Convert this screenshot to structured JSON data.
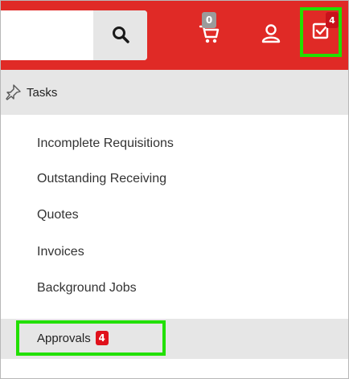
{
  "colors": {
    "brand_red": "#e02a26",
    "highlight_green": "#22e000",
    "badge_red": "#c8111b",
    "badge_gray": "#9b9b9b",
    "panel_gray": "#e6e6e6"
  },
  "topbar": {
    "search": {
      "value": "",
      "placeholder": "",
      "icon": "search-icon"
    },
    "cart": {
      "icon": "cart-icon",
      "count": "0"
    },
    "user": {
      "icon": "user-icon"
    },
    "tasks": {
      "icon": "checkbox-icon",
      "count": "4"
    }
  },
  "panel": {
    "header": {
      "icon": "pin-icon",
      "title": "Tasks"
    },
    "items": [
      {
        "label": "Incomplete Requisitions"
      },
      {
        "label": "Outstanding Receiving"
      },
      {
        "label": "Quotes"
      },
      {
        "label": "Invoices"
      },
      {
        "label": "Background Jobs"
      }
    ],
    "approvals": {
      "label": "Approvals",
      "count": "4"
    }
  }
}
